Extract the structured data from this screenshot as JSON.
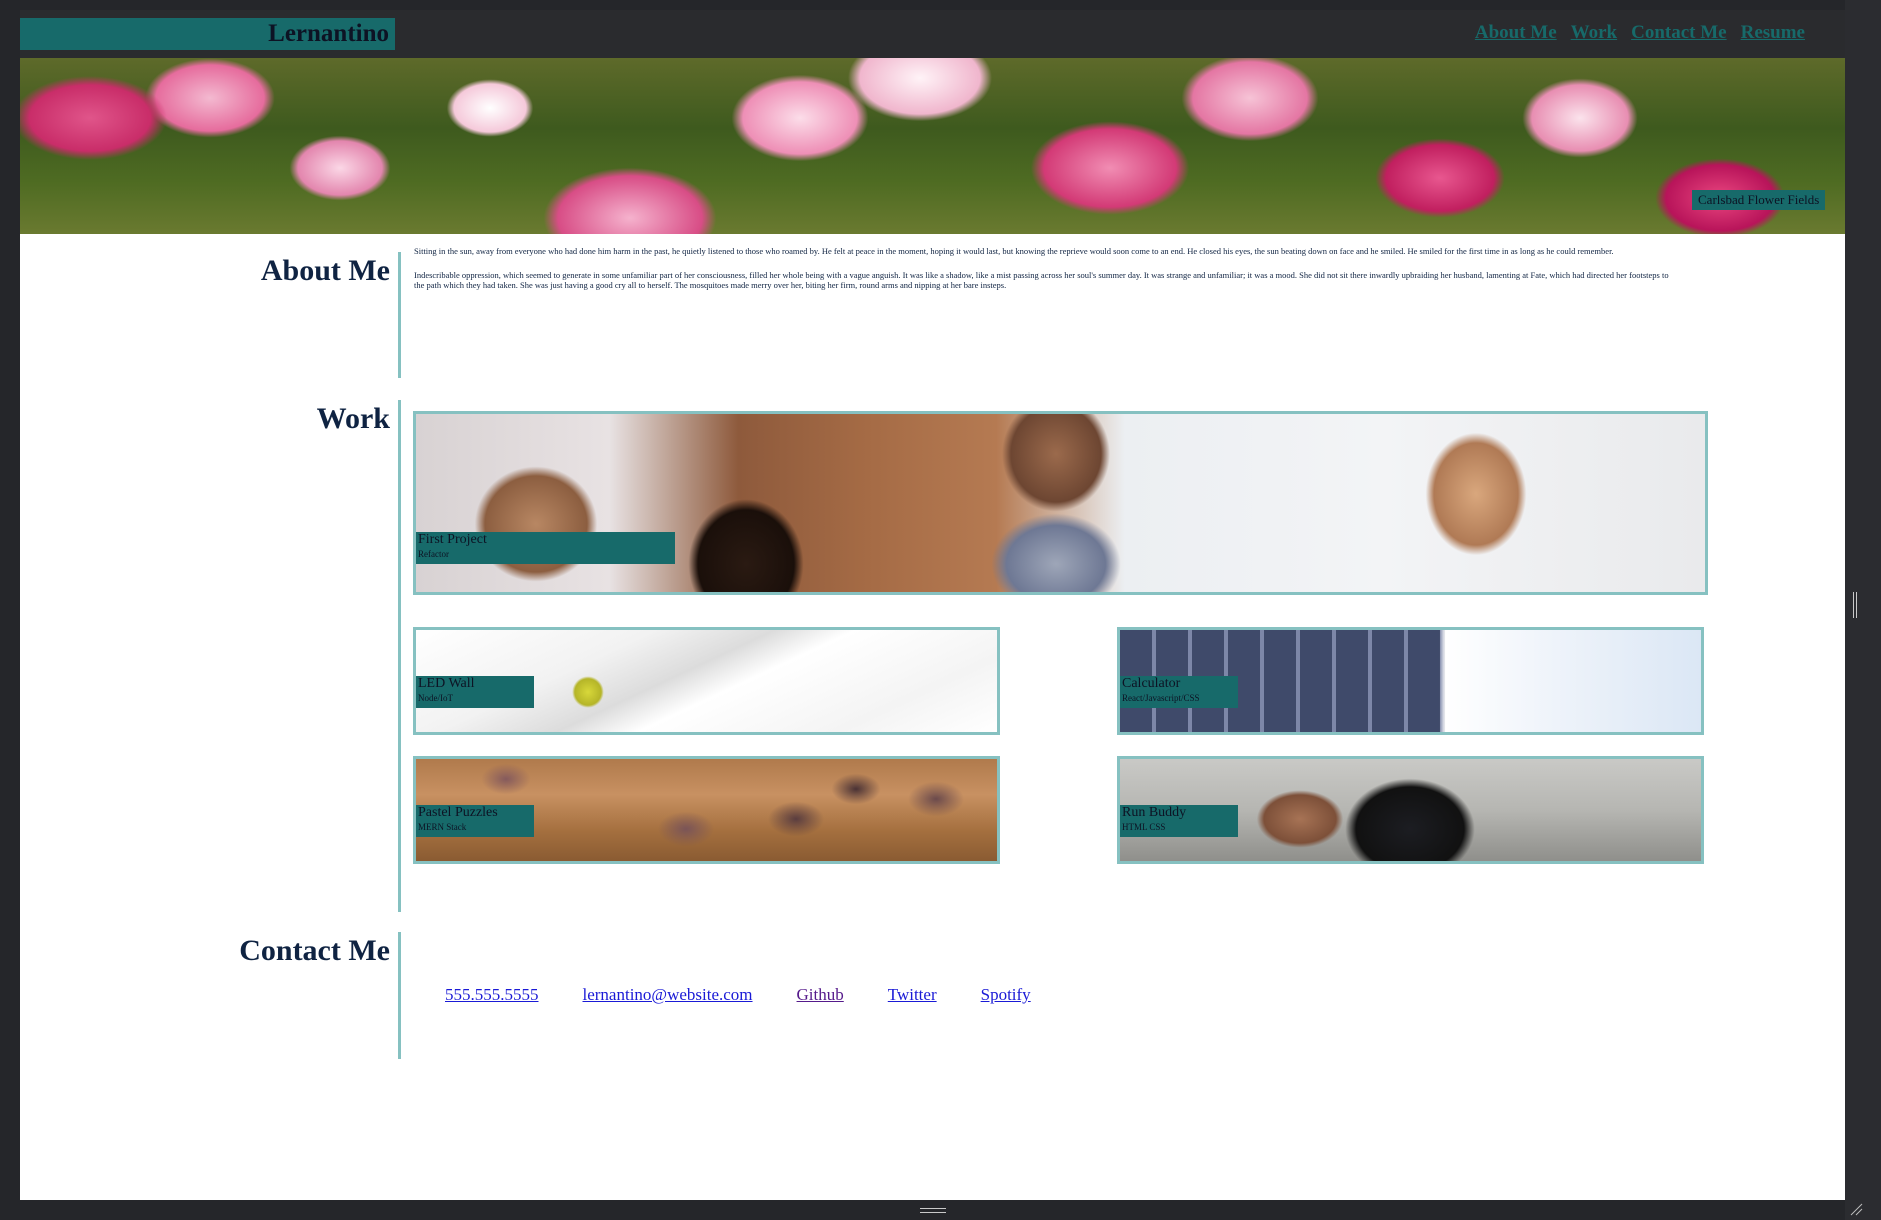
{
  "header": {
    "brand": "Lernantino",
    "nav": [
      "About Me",
      "Work",
      "Contact Me",
      "Resume"
    ]
  },
  "hero": {
    "caption": "Carlsbad Flower Fields"
  },
  "about": {
    "title": "About Me",
    "paragraphs": [
      "Sitting in the sun, away from everyone who had done him harm in the past, he quietly listened to those who roamed by. He felt at peace in the moment, hoping it would last, but knowing the reprieve would soon come to an end. He closed his eyes, the sun beating down on face and he smiled. He smiled for the first time in as long as he could remember.",
      "Indescribable oppression, which seemed to generate in some unfamiliar part of her consciousness, filled her whole being with a vague anguish. It was like a shadow, like a mist passing across her soul's summer day. It was strange and unfamiliar; it was a mood. She did not sit there inwardly upbraiding her husband, lamenting at Fate, which had directed her footsteps to the path which they had taken. She was just having a good cry all to herself. The mosquitoes made merry over her, biting her firm, round arms and nipping at her bare insteps."
    ]
  },
  "work": {
    "title": "Work",
    "projects": [
      {
        "title": "First Project",
        "subtitle": "Refactor"
      },
      {
        "title": "LED Wall",
        "subtitle": "Node/IoT"
      },
      {
        "title": "Calculator",
        "subtitle": "React/Javascript/CSS"
      },
      {
        "title": "Pastel Puzzles",
        "subtitle": "MERN Stack"
      },
      {
        "title": "Run Buddy",
        "subtitle": "HTML CSS"
      }
    ]
  },
  "contact": {
    "title": "Contact Me",
    "links": [
      "555.555.5555",
      "lernantino@website.com",
      "Github",
      "Twitter",
      "Spotify"
    ]
  },
  "colors": {
    "accent": "#176a6a",
    "border": "#86c1c1",
    "heading": "#0f2342",
    "chrome": "#25262a"
  }
}
